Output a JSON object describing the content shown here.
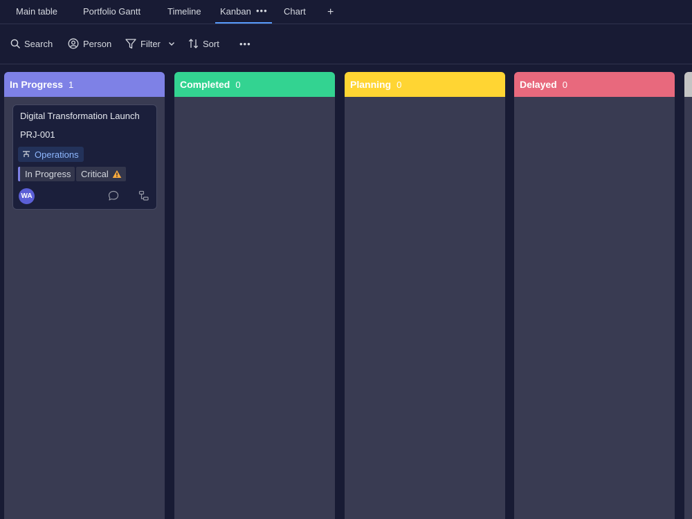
{
  "tabs": [
    {
      "label": "Main table",
      "active": false
    },
    {
      "label": "Portfolio Gantt",
      "active": false
    },
    {
      "label": "Timeline",
      "active": false
    },
    {
      "label": "Kanban",
      "active": true
    },
    {
      "label": "Chart",
      "active": false
    }
  ],
  "tab_menu_glyph": "•••",
  "add_tab_glyph": "+",
  "toolbar": {
    "search_label": "Search",
    "person_label": "Person",
    "filter_label": "Filter",
    "sort_label": "Sort",
    "more_glyph": "•••"
  },
  "columns": [
    {
      "title": "In Progress",
      "count": "1",
      "color": "#7e81e6"
    },
    {
      "title": "Completed",
      "count": "0",
      "color": "#33d391"
    },
    {
      "title": "Planning",
      "count": "0",
      "color": "#ffd533"
    },
    {
      "title": "Delayed",
      "count": "0",
      "color": "#e8697d"
    }
  ],
  "card": {
    "title": "Digital Transformation Launch",
    "id": "PRJ-001",
    "department": "Operations",
    "status": "In Progress",
    "priority": "Critical",
    "avatar_initials": "WA"
  },
  "icons": {
    "search": "search-icon",
    "person": "person-icon",
    "filter": "filter-icon",
    "sort": "sort-icon",
    "department": "department-icon",
    "warning": "warning-icon",
    "comment": "comment-icon",
    "subitems": "subitems-icon"
  }
}
